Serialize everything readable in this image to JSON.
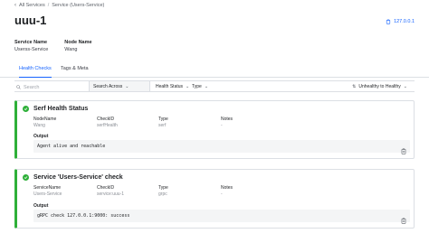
{
  "breadcrumb": {
    "back_icon": "chevron-left-icon",
    "all_services": "All Services",
    "separator": "/",
    "current": "Service (Users-Service)"
  },
  "page": {
    "title": "uuu-1"
  },
  "address": {
    "icon": "clipboard-icon",
    "value": "127.0.0.1"
  },
  "meta": {
    "service_name_label": "Service Name",
    "service_name_value": "Userss-Service",
    "node_name_label": "Node Name",
    "node_name_value": "Wang"
  },
  "tabs": {
    "health_checks": "Health Checks",
    "tags_meta": "Tags & Meta"
  },
  "filters": {
    "search_placeholder": "Search",
    "search_across": "Search Across",
    "health_status": "Health Status",
    "type": "Type",
    "sort": "Unhealthy to Healthy"
  },
  "checks": [
    {
      "title": "Serf Health Status",
      "col1_label": "NodeName",
      "col1_value": "Wang",
      "col2_label": "CheckID",
      "col2_value": "serfHealth",
      "col3_label": "Type",
      "col3_value": "serf",
      "col4_label": "Notes",
      "col4_value": "-",
      "output_label": "Output",
      "output": "Agent alive and reachable"
    },
    {
      "title": "Service 'Users-Service' check",
      "col1_label": "ServiceName",
      "col1_value": "Users-Service",
      "col2_label": "CheckID",
      "col2_value": "service:uuu-1",
      "col3_label": "Type",
      "col3_value": "grpc",
      "col4_label": "Notes",
      "col4_value": "-",
      "output_label": "Output",
      "output": "gRPC check 127.0.0.1:9000: success"
    }
  ],
  "colors": {
    "accent": "#1563ff",
    "passing": "#2eb039",
    "border": "#dcdfe4"
  }
}
